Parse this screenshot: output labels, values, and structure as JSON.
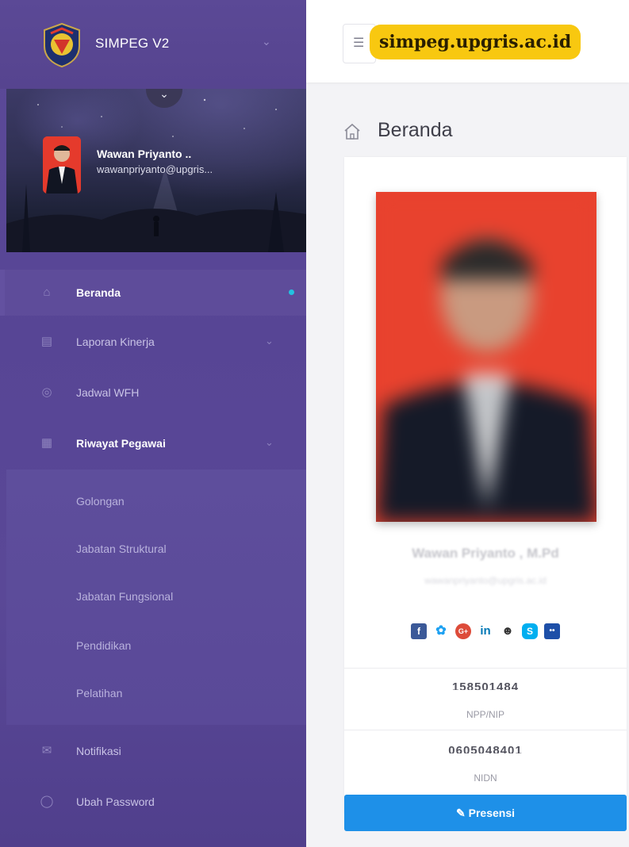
{
  "app": {
    "title": "SIMPEG V2"
  },
  "url_badge": "simpeg.upgris.ac.id",
  "user": {
    "name": "Wawan Priyanto ..",
    "email": "wawanpriyanto@upgris..."
  },
  "sidebar": {
    "items": [
      {
        "label": "Beranda",
        "icon": "home-icon",
        "active": true
      },
      {
        "label": "Laporan Kinerja",
        "icon": "report-icon"
      },
      {
        "label": "Jadwal WFH",
        "icon": "globe-icon"
      },
      {
        "label": "Riwayat Pegawai",
        "icon": "calendar-icon"
      }
    ],
    "submenu": [
      "Golongan",
      "Jabatan Struktural",
      "Jabatan Fungsional",
      "Pendidikan",
      "Pelatihan"
    ],
    "bottom_items": [
      {
        "label": "Notifikasi",
        "icon": "mail-icon"
      },
      {
        "label": "Ubah Password",
        "icon": "shield-icon"
      }
    ]
  },
  "page": {
    "title": "Beranda"
  },
  "profile": {
    "name": "Wawan Priyanto , M.Pd",
    "email": "wawanpriyanto@upgris.ac.id",
    "social_icons": [
      "facebook-icon",
      "twitter-icon",
      "google-plus-icon",
      "linkedin-icon",
      "reddit-icon",
      "skype-icon",
      "flickr-icon"
    ],
    "stats": [
      {
        "value": "158501484",
        "label": "NPP/NIP"
      },
      {
        "value": "0605048401",
        "label": "NIDN"
      }
    ],
    "presensi_label": "Presensi"
  },
  "colors": {
    "sidebar": "#574595",
    "accent": "#1e90e8",
    "badge": "#f8c810",
    "active_dot": "#23c2e0"
  }
}
